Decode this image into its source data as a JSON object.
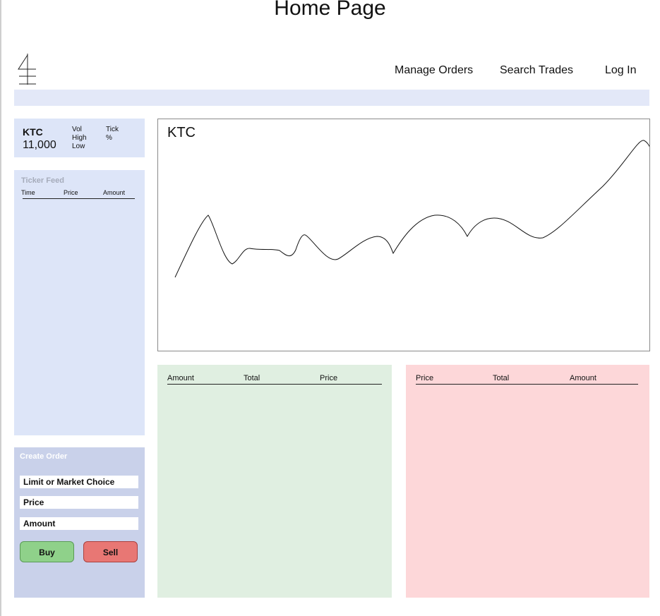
{
  "page": {
    "title": "Home Page"
  },
  "logo": {
    "icon": "brand-logo-icon"
  },
  "nav": {
    "manage_orders": "Manage Orders",
    "search_trades": "Search Trades",
    "log_in": "Log In"
  },
  "ticker": {
    "symbol": "KTC",
    "price": "11,000",
    "vol_label": "Vol",
    "high_label": "High",
    "low_label": "Low",
    "tick_label": "Tick",
    "percent_label": "%"
  },
  "feed": {
    "title": "Ticker Feed",
    "columns": [
      "Time",
      "Price",
      "Amount"
    ]
  },
  "order_form": {
    "title": "Create Order",
    "type_field": "Limit or Market Choice",
    "price_field": "Price",
    "amount_field": "Amount",
    "buy_label": "Buy",
    "sell_label": "Sell"
  },
  "chart": {
    "label": "KTC"
  },
  "buy_book": {
    "columns": [
      "Amount",
      "Total",
      "Price"
    ]
  },
  "sell_book": {
    "columns": [
      "Price",
      "Total",
      "Amount"
    ]
  },
  "colors": {
    "panel_blue": "#dde5f8",
    "order_panel": "#c9d1ea",
    "buy_green": "#8fd18a",
    "sell_red": "#e87774",
    "buy_book_bg": "#e0efe1",
    "sell_book_bg": "#fdd7d9"
  }
}
